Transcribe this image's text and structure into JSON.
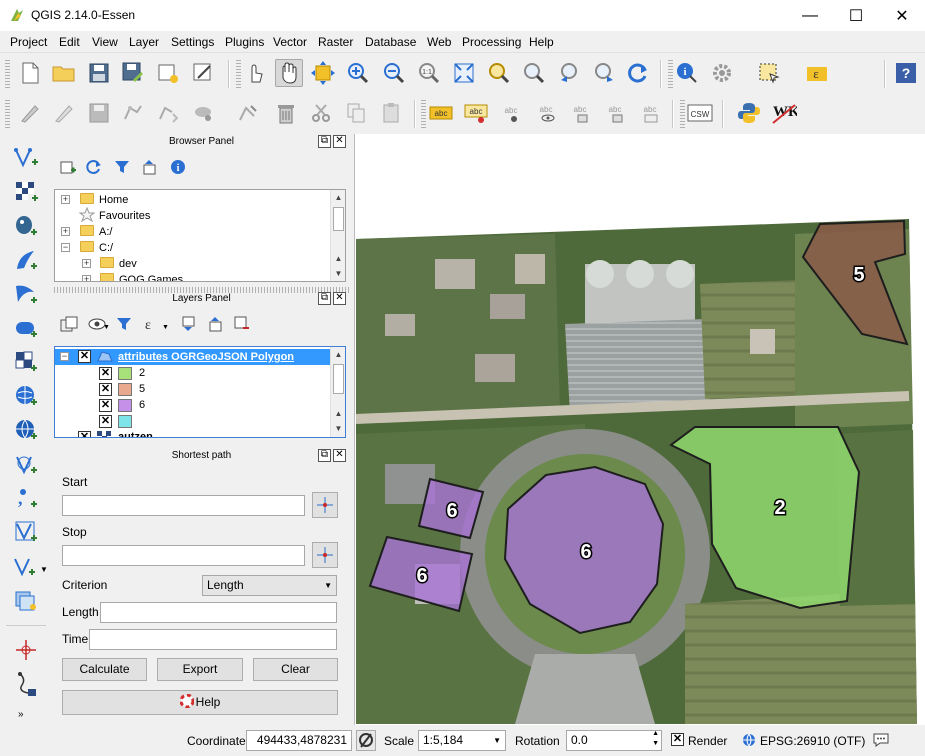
{
  "window": {
    "title": "QGIS 2.14.0-Essen",
    "minimize": "—",
    "maximize": "☐",
    "close": "✕"
  },
  "menu": [
    "Project",
    "Edit",
    "View",
    "Layer",
    "Settings",
    "Plugins",
    "Vector",
    "Raster",
    "Database",
    "Web",
    "Processing",
    "Help"
  ],
  "toolbar": {
    "overflow": "»",
    "csw": "CSW",
    "wkt": "WKT",
    "abc": "abc"
  },
  "browser_panel": {
    "title": "Browser Panel",
    "items": [
      "Home",
      "Favourites",
      "A:/",
      "C:/",
      "dev",
      "GOG Games"
    ]
  },
  "layers_panel": {
    "title": "Layers Panel",
    "layer_name": "attributes OGRGeoJSON Polygon",
    "classes": [
      {
        "label": "2",
        "color": "#a8e07a"
      },
      {
        "label": "5",
        "color": "#e8a98f"
      },
      {
        "label": "6",
        "color": "#c490e8"
      },
      {
        "label": "",
        "color": "#7fe3ea"
      }
    ],
    "second_layer": "autzen"
  },
  "shortest_path": {
    "title": "Shortest path",
    "start_label": "Start",
    "stop_label": "Stop",
    "criterion_label": "Criterion",
    "criterion_value": "Length",
    "length_label": "Length",
    "time_label": "Time",
    "calculate": "Calculate",
    "export": "Export",
    "clear": "Clear",
    "help": "Help"
  },
  "map": {
    "polygons": [
      {
        "label": "5",
        "color": "#8a5a48"
      },
      {
        "label": "6",
        "color": "#a873d6"
      },
      {
        "label": "6",
        "color": "#a873d6"
      },
      {
        "label": "6",
        "color": "#a873d6"
      },
      {
        "label": "2",
        "color": "#94e070"
      }
    ]
  },
  "status": {
    "coordinate_label": "Coordinate",
    "coordinate": "494433,4878231",
    "scale_label": "Scale",
    "scale": "1:5,184",
    "rotation_label": "Rotation",
    "rotation": "0.0",
    "render_label": "Render",
    "crs": "EPSG:26910 (OTF)"
  }
}
